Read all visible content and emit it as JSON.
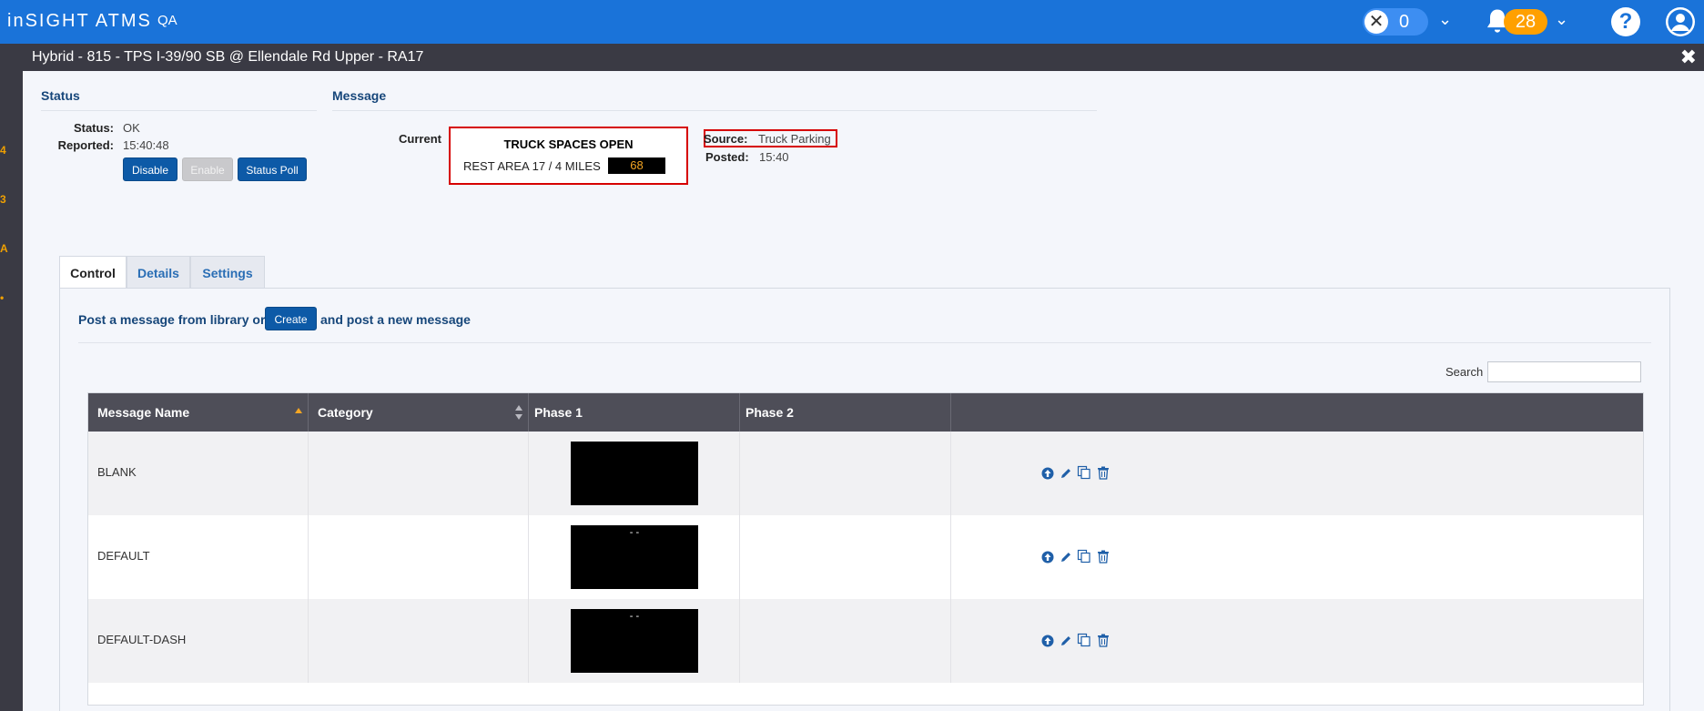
{
  "app": {
    "brand": "inSIGHT ATMS",
    "env": "QA"
  },
  "topbar": {
    "counter": "0",
    "notifications": "28",
    "help": "?"
  },
  "window": {
    "title": "Hybrid - 815 - TPS I-39/90 SB @ Ellendale Rd Upper - RA17",
    "close": "✖"
  },
  "status": {
    "heading": "Status",
    "status_label": "Status:",
    "status_value": "OK",
    "reported_label": "Reported:",
    "reported_value": "15:40:48",
    "buttons": {
      "disable": "Disable",
      "enable": "Enable",
      "poll": "Status Poll"
    }
  },
  "message": {
    "heading": "Message",
    "current_label": "Current",
    "sign_line1": "TRUCK SPACES OPEN",
    "sign_line2": "REST AREA 17 / 4 MILES",
    "sign_count": "68",
    "source_label": "Source:",
    "source_value": "Truck Parking",
    "posted_label": "Posted:",
    "posted_value": "15:40"
  },
  "tabs": [
    "Control",
    "Details",
    "Settings"
  ],
  "control": {
    "post_prefix": "Post a message from library or",
    "create": "Create",
    "post_suffix": "and post a new message",
    "search_label": "Search",
    "search_value": ""
  },
  "table": {
    "headers": [
      "Message Name",
      "Category",
      "Phase 1",
      "Phase 2",
      ""
    ],
    "rows": [
      {
        "name": "BLANK",
        "category": "",
        "phase1_text": ""
      },
      {
        "name": "DEFAULT",
        "category": "",
        "phase1_text": "- -"
      },
      {
        "name": "DEFAULT-DASH",
        "category": "",
        "phase1_text": "- -"
      }
    ]
  },
  "colors": {
    "brand_blue": "#1a73d9",
    "header_dark": "#3a3a44",
    "button_blue": "#0d5aa7",
    "highlight_red": "#d60000",
    "badge_orange": "#ffa000"
  }
}
